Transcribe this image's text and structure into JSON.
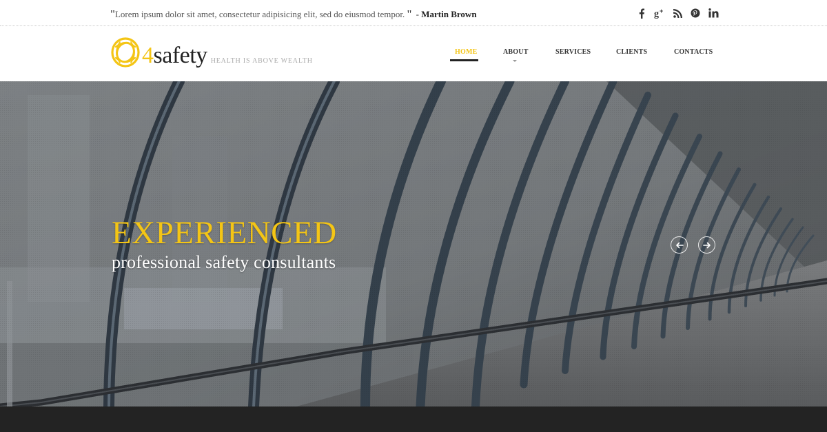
{
  "topbar": {
    "quote_open": "\"",
    "quote_text": "Lorem ipsum dolor sit amet, consectetur adipisicing elit, sed do eiusmod tempor. ",
    "quote_close": "\"",
    "dash": "-",
    "author": "Martin Brown",
    "social": [
      {
        "name": "facebook-icon",
        "glyph": "f"
      },
      {
        "name": "google-plus-icon",
        "glyph": "g+"
      },
      {
        "name": "rss-icon",
        "glyph": "rss"
      },
      {
        "name": "pinterest-icon",
        "glyph": "p"
      },
      {
        "name": "linkedin-icon",
        "glyph": "in"
      }
    ]
  },
  "header": {
    "logo_number": "4",
    "logo_word": "safety",
    "tagline": "HEALTH IS ABOVE WEALTH",
    "nav": [
      {
        "label": "HOME",
        "active": true
      },
      {
        "label": "ABOUT",
        "active": false,
        "has_dropdown": true
      },
      {
        "label": "SERVICES",
        "active": false
      },
      {
        "label": "CLIENTS",
        "active": false
      },
      {
        "label": "CONTACTS",
        "active": false
      }
    ]
  },
  "hero": {
    "title": "EXPERIENCED",
    "subtitle": "professional safety consultants",
    "prev_icon": "arrow-left-icon",
    "next_icon": "arrow-right-icon"
  },
  "colors": {
    "accent": "#f4c515",
    "text_dark": "#222222",
    "band": "#232323"
  }
}
